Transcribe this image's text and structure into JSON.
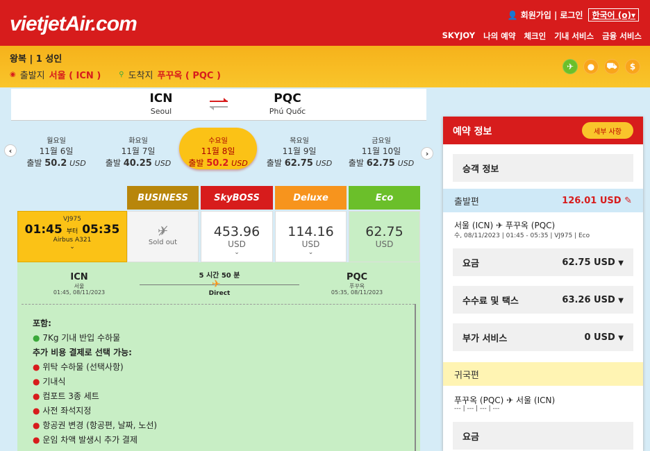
{
  "header": {
    "logo": "vietjetAir.com",
    "signup": "회원가입",
    "login": "로그인",
    "language": "한국어",
    "nav": [
      "SKYJOY",
      "나의 예약",
      "체크인",
      "기내 서비스",
      "금융 서비스"
    ]
  },
  "search": {
    "trip_type": "왕복 | 1 성인",
    "origin_label": "출발지",
    "origin_value": "서울 ( ICN )",
    "dest_label": "도착지",
    "dest_value": "푸꾸옥 ( PQC )"
  },
  "route": {
    "from_code": "ICN",
    "from_city": "Seoul",
    "to_code": "PQC",
    "to_city": "Phú Quốc"
  },
  "dates": [
    {
      "weekday": "월요일",
      "date": "11월 6일",
      "prefix": "출발",
      "price": "50.2",
      "currency": "USD"
    },
    {
      "weekday": "화요일",
      "date": "11월 7일",
      "prefix": "출발",
      "price": "40.25",
      "currency": "USD"
    },
    {
      "weekday": "수요일",
      "date": "11월 8일",
      "prefix": "출발",
      "price": "50.2",
      "currency": "USD"
    },
    {
      "weekday": "목요일",
      "date": "11월 9일",
      "prefix": "출발",
      "price": "62.75",
      "currency": "USD"
    },
    {
      "weekday": "금요일",
      "date": "11월 10일",
      "prefix": "출발",
      "price": "62.75",
      "currency": "USD"
    }
  ],
  "fare_classes": [
    {
      "name": "BUSINESS",
      "color": "#b8860b"
    },
    {
      "name": "SkyBOSS",
      "color": "#d71c1c"
    },
    {
      "name": "Deluxe",
      "color": "#f7941d"
    },
    {
      "name": "Eco",
      "color": "#6bbf2a"
    }
  ],
  "flight": {
    "number": "VJ975",
    "depart": "01:45",
    "sep": "부터",
    "arrive": "05:35",
    "aircraft": "Airbus A321",
    "fares": [
      "Sold out",
      "453.96",
      "114.16",
      "62.75"
    ],
    "currency": "USD"
  },
  "detail": {
    "from_code": "ICN",
    "from_city": "서울",
    "from_time": "01:45, 08/11/2023",
    "to_code": "PQC",
    "to_city": "푸꾸옥",
    "to_time": "05:35, 08/11/2023",
    "duration": "5 시간 50 분",
    "stop": "Direct",
    "included_title": "포함:",
    "included": [
      "7Kg 기내 반입 수하물"
    ],
    "optional_title": "추가 비용 결제로 선택 가능:",
    "optional": [
      "위탁 수하물 (선택사항)",
      "기내식",
      "컴포트 3종 세트",
      "사전 좌석지정",
      "항공권 변경 (항공편, 날짜, 노선)",
      "운임 차액 발생시 추가 결제"
    ]
  },
  "booking": {
    "title": "예약 정보",
    "detail_button": "세부 사항",
    "passenger": "승객 정보",
    "outbound_label": "출발편",
    "outbound_price": "126.01 USD",
    "outbound_route": "서울 (ICN) ✈ 푸꾸옥 (PQC)",
    "outbound_info": "수, 08/11/2023 | 01:45 - 05:35 | VJ975 | Eco",
    "fare_label": "요금",
    "fare_value": "62.75 USD",
    "tax_label": "수수료 및 택스",
    "tax_value": "63.26 USD",
    "addon_label": "부가 서비스",
    "addon_value": "0 USD",
    "return_label": "귀국편",
    "return_route": "푸꾸옥 (PQC) ✈ 서울 (ICN)",
    "return_info": "--- | --- | --- | ---",
    "return_fare_label": "요금"
  }
}
